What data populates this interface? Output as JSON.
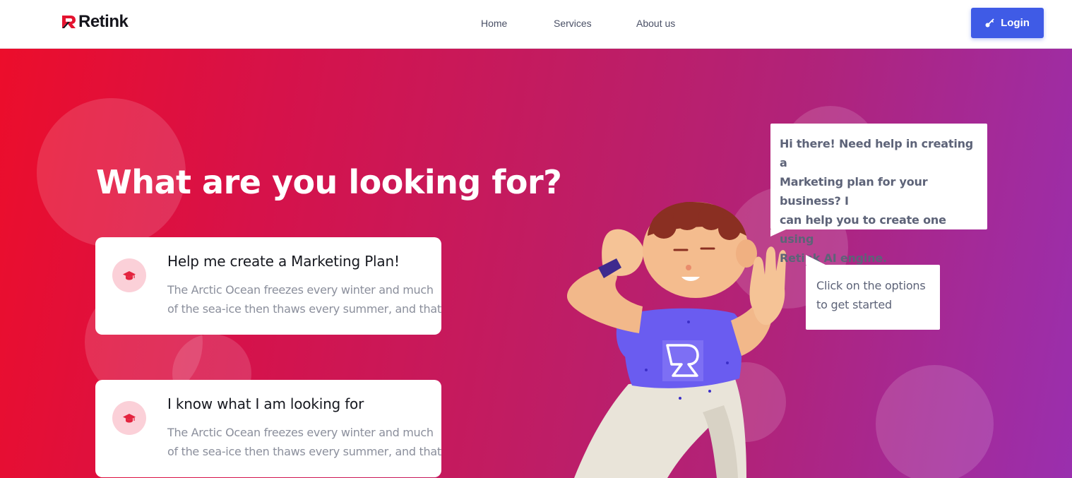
{
  "header": {
    "logo_text": "Retink",
    "nav": [
      {
        "label": "Home"
      },
      {
        "label": "Services"
      },
      {
        "label": "About us"
      }
    ],
    "login_label": "Login"
  },
  "hero": {
    "title": "What are you looking for?",
    "cards": [
      {
        "title": "Help me create a Marketing Plan!",
        "desc_line1": "The Arctic Ocean freezes every winter and much",
        "desc_line2": "of the sea-ice then thaws every summer, and that",
        "icon": "graduation-cap-icon"
      },
      {
        "title": "I know what I am looking for",
        "desc_line1": "The Arctic Ocean freezes every winter and much",
        "desc_line2": "of the sea-ice then thaws every summer, and that",
        "icon": "graduation-cap-icon"
      }
    ],
    "speech_main_lines": [
      "Hi there! Need help in creating a",
      "Marketing plan for your business? I",
      "can help you to create one using",
      "Retink AI engine."
    ],
    "speech_hint_lines": [
      "Click on the options",
      "to get started"
    ]
  },
  "colors": {
    "primary_button": "#3f5be6",
    "gradient_start": "#ec0d2b",
    "gradient_end": "#9a2fae",
    "icon_bg": "#fbd0d8",
    "icon_fg": "#e4243f"
  }
}
